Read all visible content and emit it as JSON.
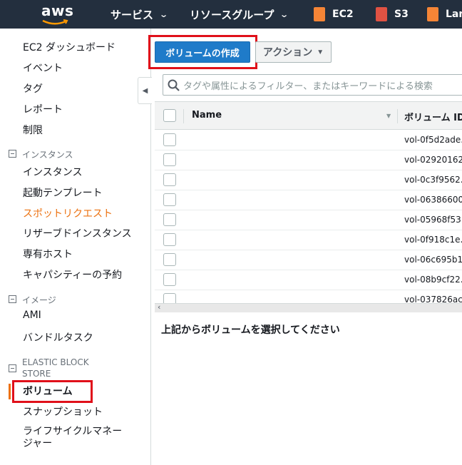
{
  "topnav": {
    "logo": "aws",
    "services": "サービス",
    "resource_groups": "リソースグループ",
    "favorites": [
      {
        "label": "EC2",
        "color": "#f58536"
      },
      {
        "label": "S3",
        "color": "#e05243"
      },
      {
        "label": "Lam",
        "color": "#f58536"
      }
    ]
  },
  "sidebar": {
    "dashboard": "EC2 ダッシュボード",
    "events": "イベント",
    "tags": "タグ",
    "reports": "レポート",
    "limits": "制限",
    "section_instances": "インスタンス",
    "instances": "インスタンス",
    "launch_templates": "起動テンプレート",
    "spot_requests": "スポットリクエスト",
    "reserved_instances": "リザーブドインスタンス",
    "dedicated_hosts": "専有ホスト",
    "capacity_reservations": "キャパシティーの予約",
    "section_images": "イメージ",
    "ami": "AMI",
    "bundle_tasks": "バンドルタスク",
    "section_ebs_line1": "ELASTIC BLOCK",
    "section_ebs_line2": "STORE",
    "volumes": "ボリューム",
    "snapshots": "スナップショット",
    "lifecycle_line1": "ライフサイクルマネー",
    "lifecycle_line2": "ジャー"
  },
  "toolbar": {
    "create_volume": "ボリュームの作成",
    "actions": "アクション"
  },
  "search": {
    "placeholder": "タグや属性によるフィルター、またはキーワードによる検索"
  },
  "table": {
    "columns": [
      "Name",
      "ボリューム ID"
    ],
    "rows": [
      {
        "name": "",
        "volume_id": "vol-0f5d2ade..."
      },
      {
        "name": "",
        "volume_id": "vol-02920162..."
      },
      {
        "name": "",
        "volume_id": "vol-0c3f9562..."
      },
      {
        "name": "",
        "volume_id": "vol-06386600..."
      },
      {
        "name": "",
        "volume_id": "vol-05968f53..."
      },
      {
        "name": "",
        "volume_id": "vol-0f918c1e..."
      },
      {
        "name": "",
        "volume_id": "vol-06c695b1..."
      },
      {
        "name": "",
        "volume_id": "vol-08b9cf22..."
      },
      {
        "name": "",
        "volume_id": "vol-037826ac..."
      }
    ]
  },
  "details_hint": "上記からボリュームを選択してください",
  "colors": {
    "nav_bg": "#232f3e",
    "primary_button": "#1f7bc9",
    "active_link": "#ec7211",
    "highlight_box": "#e0101a"
  }
}
